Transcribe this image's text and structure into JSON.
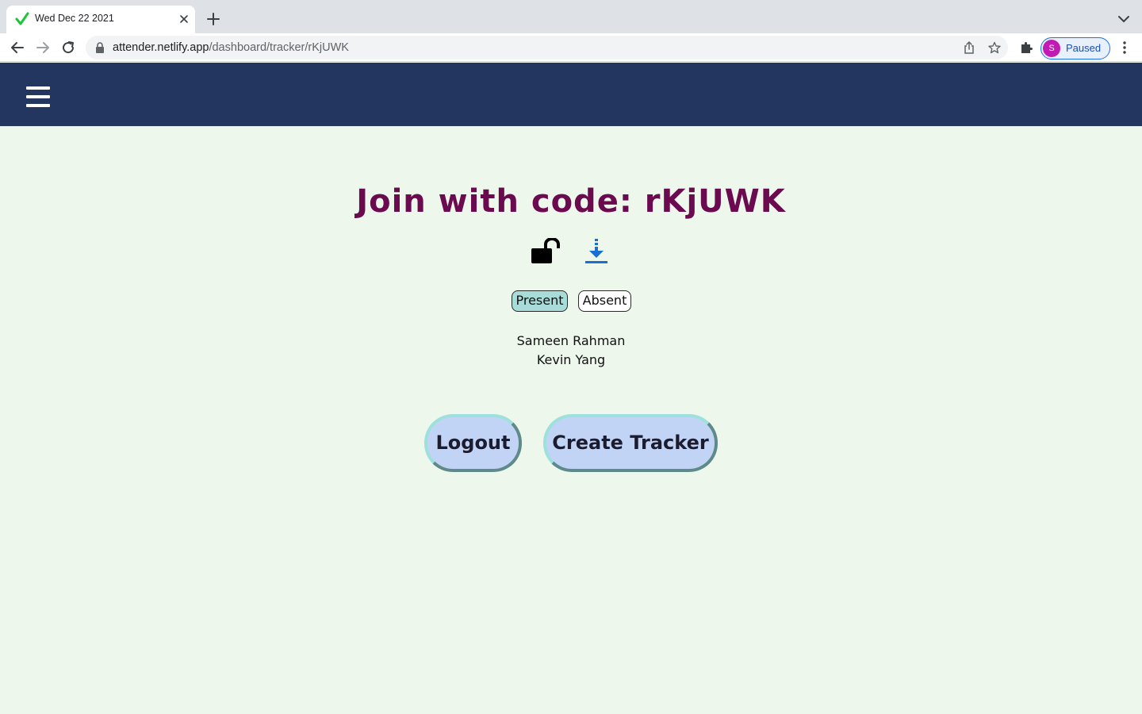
{
  "browser": {
    "tab_title": "Wed Dec 22 2021",
    "url_host": "attender.netlify.app",
    "url_path": "/dashboard/tracker/rKjUWK",
    "profile_initial": "S",
    "profile_status": "Paused"
  },
  "header": {
    "menu_icon": "hamburger-icon",
    "background": "#223660"
  },
  "main": {
    "title": "Join with code: rKjUWK",
    "icons": [
      "unlock-icon",
      "download-icon"
    ],
    "filters": {
      "present_label": "Present",
      "absent_label": "Absent",
      "selected": "Present"
    },
    "attendees": [
      "Sameen Rahman",
      "Kevin Yang"
    ]
  },
  "actions": {
    "logout_label": "Logout",
    "create_label": "Create Tracker"
  },
  "colors": {
    "title": "#6b0a4f",
    "page_background": "#edf7ec",
    "present_active": "#a8dcd8",
    "pill_fill": "#c2d4f5",
    "download_blue": "#1a6fd0"
  }
}
